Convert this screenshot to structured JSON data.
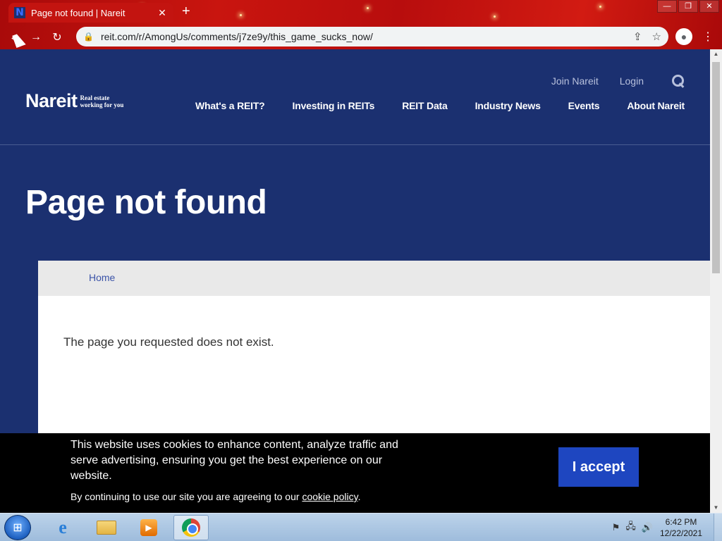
{
  "browser": {
    "tab_title": "Page not found | Nareit",
    "tab_favicon": "N",
    "tab_close": "✕",
    "new_tab": "+",
    "url": "reit.com/r/AmongUs/comments/j7ze9y/this_game_sucks_now/",
    "window_controls": [
      "—",
      "❐",
      "✕"
    ]
  },
  "site": {
    "logo_main": "Nareit",
    "logo_tag_line1": "Real estate",
    "logo_tag_line2": "working for you",
    "util_nav": [
      "Join Nareit",
      "Login"
    ],
    "main_nav": [
      "What's a REIT?",
      "Investing in REITs",
      "REIT Data",
      "Industry News",
      "Events",
      "About Nareit"
    ],
    "page_title": "Page not found",
    "breadcrumb": "Home",
    "message": "The page you requested does not exist."
  },
  "cookie_banner": {
    "text": "This website uses cookies to enhance content, analyze traffic and serve advertising, ensuring you get the best experience on our website.",
    "sub_prefix": "By continuing to use our site you are agreeing to our ",
    "link": "cookie policy",
    "sub_suffix": ".",
    "accept": "I accept"
  },
  "taskbar": {
    "time": "6:42 PM",
    "date": "12/22/2021"
  },
  "colors": {
    "header_bg": "#1b3070",
    "accept_button": "#1e46c0",
    "chrome_frame": "#c31410"
  }
}
